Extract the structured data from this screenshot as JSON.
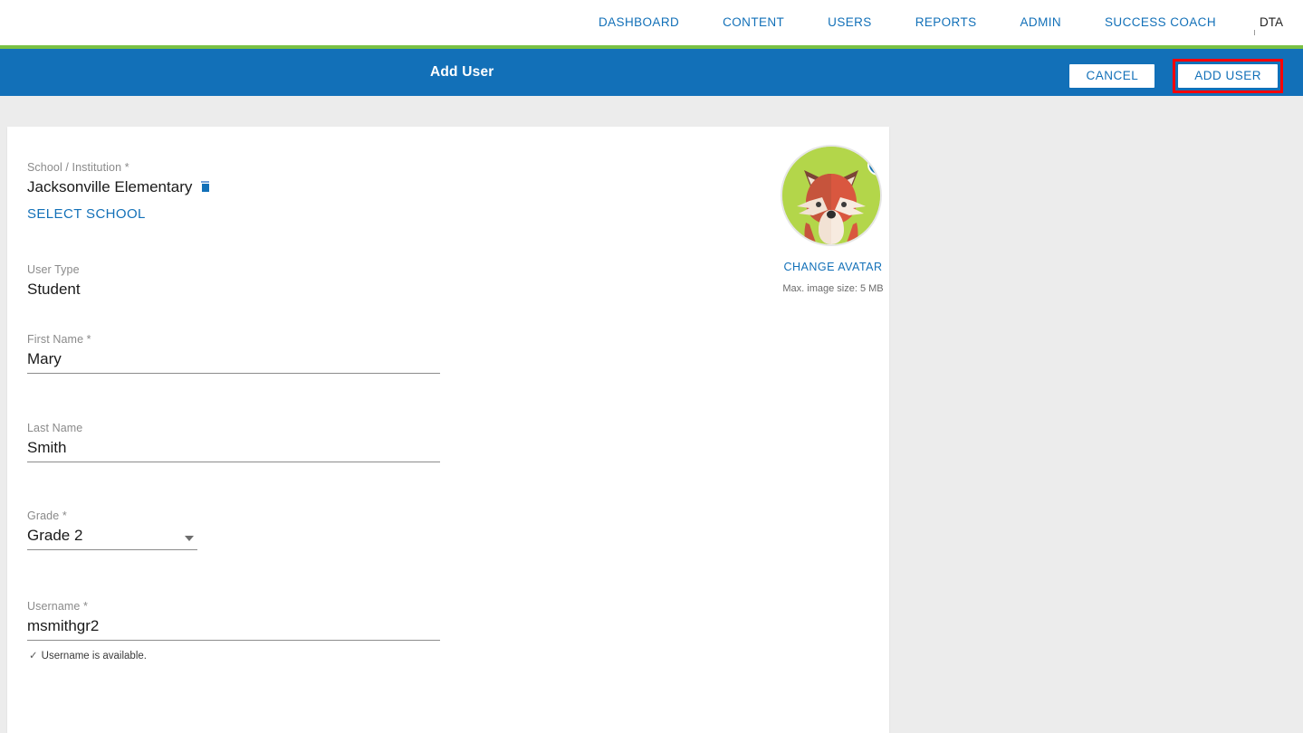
{
  "nav": {
    "items": [
      {
        "label": "DASHBOARD",
        "name": "nav-dashboard"
      },
      {
        "label": "CONTENT",
        "name": "nav-content"
      },
      {
        "label": "USERS",
        "name": "nav-users"
      },
      {
        "label": "REPORTS",
        "name": "nav-reports"
      },
      {
        "label": "ADMIN",
        "name": "nav-admin"
      },
      {
        "label": "SUCCESS COACH",
        "name": "nav-success-coach"
      }
    ],
    "user_label": "DTA",
    "accent_green": "#7ac143",
    "accent_blue": "#1270b8"
  },
  "actionbar": {
    "title": "Add User",
    "cancel_label": "CANCEL",
    "submit_label": "ADD USER",
    "highlight_color": "#ff0000",
    "background": "#1270b8"
  },
  "form": {
    "school": {
      "label": "School / Institution  *",
      "value": "Jacksonville Elementary",
      "select_link": "SELECT SCHOOL"
    },
    "user_type": {
      "label": "User Type",
      "value": "Student"
    },
    "first_name": {
      "label": "First Name *",
      "value": "Mary",
      "placeholder": "First Name"
    },
    "last_name": {
      "label": "Last Name",
      "value": "Smith",
      "placeholder": "Last Name"
    },
    "grade": {
      "label": "Grade *",
      "value": "Grade 2"
    },
    "username": {
      "label": "Username *",
      "value": "msmithgr2",
      "placeholder": "Username",
      "availability": "Username is available.",
      "availability_mark": "✓"
    }
  },
  "avatar": {
    "change_label": "CHANGE AVATAR",
    "max_size_note": "Max. image size: 5 MB",
    "background_color": "#b3d64a",
    "remove_icon": "close-x-icon"
  }
}
